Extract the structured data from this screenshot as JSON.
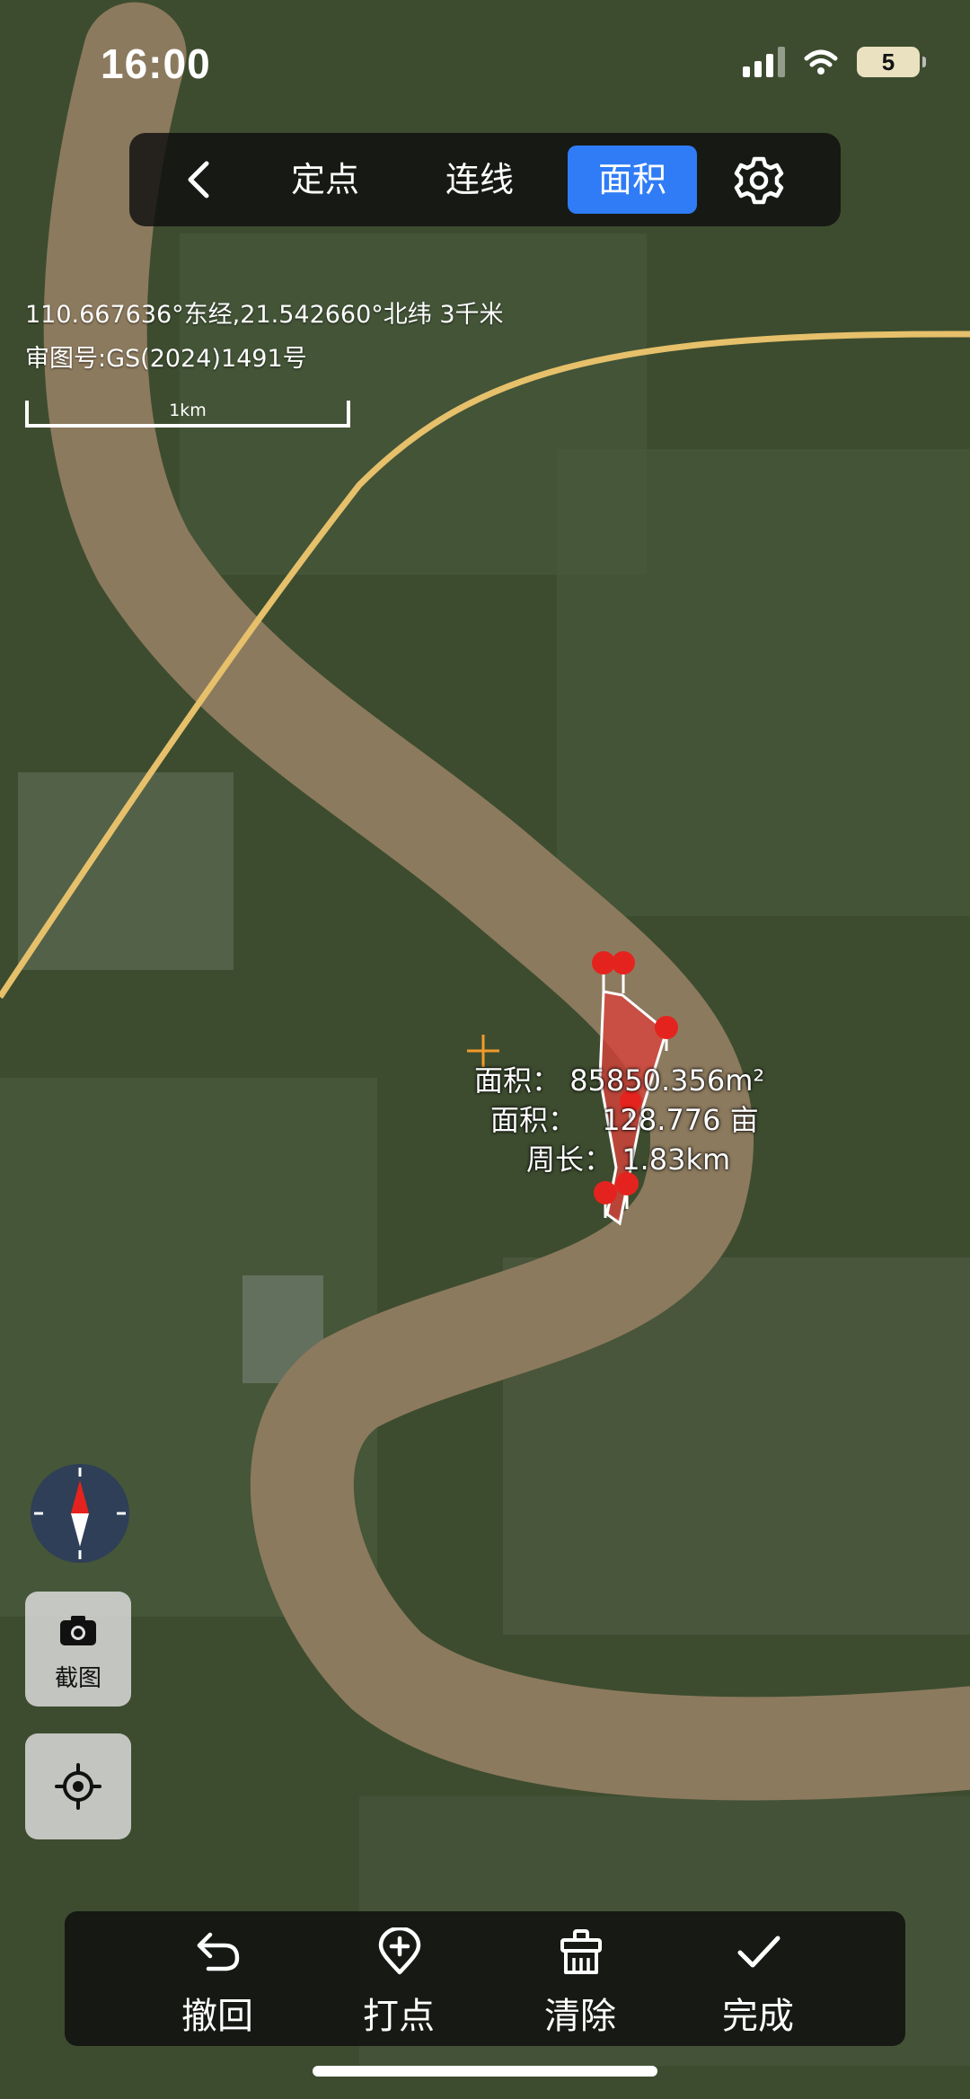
{
  "status_bar": {
    "time": "16:00",
    "battery": "5"
  },
  "topbar": {
    "tabs": [
      {
        "label": "定点",
        "active": false
      },
      {
        "label": "连线",
        "active": false
      },
      {
        "label": "面积",
        "active": true
      }
    ]
  },
  "info": {
    "coordinates": "110.667636°东经,21.542660°北纬 3千米",
    "review_number": "审图号:GS(2024)1491号",
    "scale_label": "1km"
  },
  "measurement": {
    "area_sqm_label": "面积：",
    "area_sqm_value": "85850.356m²",
    "area_mu_label": "面积：",
    "area_mu_value": "128.776 亩",
    "perimeter_label": "周长：",
    "perimeter_value": "1.83km"
  },
  "side_controls": {
    "screenshot_label": "截图"
  },
  "bottom_bar": {
    "undo_label": "撤回",
    "add_point_label": "打点",
    "clear_label": "清除",
    "done_label": "完成"
  },
  "colors": {
    "accent": "#2f7cf6",
    "polygon_fill": "#d8433c",
    "pin": "#e5231e",
    "crosshair": "#f39a2b",
    "river": "#8c7a5e",
    "road": "#e6c06a"
  },
  "icons": [
    "back-chevron-icon",
    "gear-icon",
    "compass-icon",
    "camera-icon",
    "locate-icon",
    "undo-icon",
    "add-point-icon",
    "clear-icon",
    "check-icon"
  ]
}
